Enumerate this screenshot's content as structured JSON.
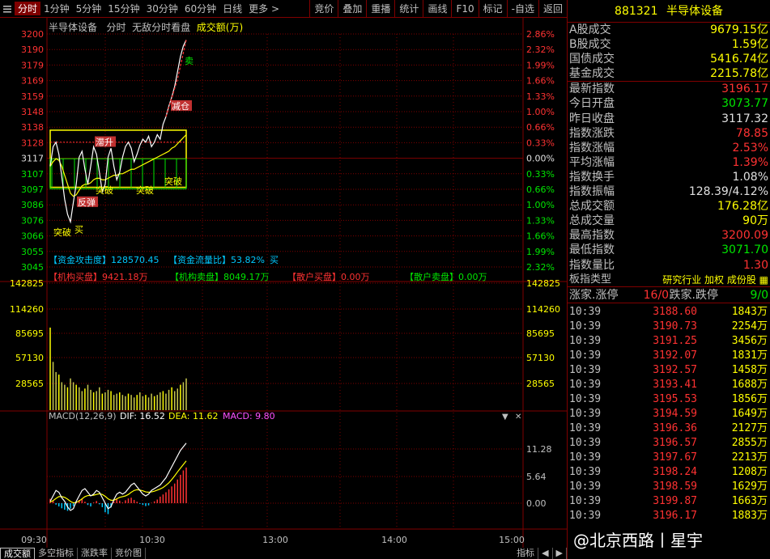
{
  "topbar": {
    "periods": [
      "分时",
      "1分钟",
      "5分钟",
      "15分钟",
      "30分钟",
      "60分钟",
      "日线",
      "更多 >"
    ],
    "tools": [
      "竞价",
      "叠加",
      "重播",
      "统计",
      "画线",
      "F10",
      "标记",
      "-自选",
      "返回"
    ]
  },
  "chart": {
    "name": "半导体设备",
    "mode": "分时",
    "desc": "无敌分时看盘",
    "sub": "成交额(万)",
    "price_axis": [
      "3200",
      "3190",
      "3179",
      "3169",
      "3159",
      "3148",
      "3138",
      "3128",
      "3117",
      "3107",
      "3097",
      "3086",
      "3076",
      "3066",
      "3055",
      "3045"
    ],
    "pct_axis": [
      "2.86%",
      "2.32%",
      "1.99%",
      "1.66%",
      "1.33%",
      "1.00%",
      "0.66%",
      "0.33%",
      "0.00%",
      "0.33%",
      "0.66%",
      "1.00%",
      "1.33%",
      "1.66%",
      "1.99%",
      "2.32%"
    ],
    "prev_close": 3117.32,
    "flow_row1": {
      "a": "【资金攻击度】128570.45",
      "b": "【资金流量比】53.82%",
      "b_tail": "买"
    },
    "flow_row2": [
      {
        "label": "【机构买盘】",
        "value": "9421.18万",
        "color": "#ff3232"
      },
      {
        "label": "【机构卖盘】",
        "value": "8049.17万",
        "color": "#00e600"
      },
      {
        "label": "【散户买盘】",
        "value": "0.00万",
        "color": "#ff3232"
      },
      {
        "label": "【散户卖盘】",
        "value": "0.00万",
        "color": "#00e600"
      }
    ],
    "vol_axis": [
      "142825",
      "114260",
      "85695",
      "57130",
      "28565"
    ],
    "macd_title": "MACD(12,26,9)",
    "macd_dif": "DIF: 16.52",
    "macd_dea": "DEA: 11.62",
    "macd_val": "MACD: 9.80",
    "macd_axis": [
      "11.28",
      "5.64",
      "0.00"
    ],
    "time_axis": [
      "09:30",
      "10:30",
      "13:00",
      "14:00",
      "15:00"
    ],
    "annotations": [
      "卖",
      "减仓",
      "滞升",
      "突破",
      "突破",
      "突破",
      "反弹",
      "突破",
      "买",
      "突破"
    ],
    "price_series": [
      3112,
      3125,
      3128,
      3120,
      3105,
      3090,
      3080,
      3075,
      3088,
      3100,
      3118,
      3122,
      3110,
      3100,
      3112,
      3125,
      3120,
      3108,
      3095,
      3100,
      3118,
      3124,
      3112,
      3103,
      3108,
      3118,
      3125,
      3128,
      3124,
      3115,
      3120,
      3126,
      3130,
      3128,
      3132,
      3125,
      3128,
      3133,
      3130,
      3140,
      3145,
      3152,
      3158,
      3165,
      3175,
      3185,
      3192,
      3196
    ],
    "avg_series": [
      3112,
      3115,
      3117,
      3116,
      3112,
      3106,
      3100,
      3094,
      3092,
      3093,
      3096,
      3099,
      3100,
      3100,
      3101,
      3103,
      3104,
      3104,
      3103,
      3103,
      3104,
      3105,
      3106,
      3106,
      3107,
      3107,
      3108,
      3109,
      3110,
      3110,
      3111,
      3112,
      3113,
      3114,
      3115,
      3116,
      3117,
      3118,
      3119,
      3120,
      3121,
      3122,
      3124,
      3125,
      3127,
      3129,
      3131,
      3133
    ],
    "volume_series": [
      0.65,
      0.38,
      0.3,
      0.28,
      0.22,
      0.2,
      0.18,
      0.25,
      0.22,
      0.2,
      0.18,
      0.15,
      0.17,
      0.2,
      0.16,
      0.14,
      0.15,
      0.18,
      0.13,
      0.14,
      0.16,
      0.15,
      0.12,
      0.13,
      0.14,
      0.12,
      0.11,
      0.13,
      0.12,
      0.1,
      0.12,
      0.14,
      0.11,
      0.12,
      0.1,
      0.13,
      0.11,
      0.12,
      0.14,
      0.15,
      0.13,
      0.16,
      0.18,
      0.15,
      0.17,
      0.2,
      0.22,
      0.25
    ],
    "macd_series": [
      1.2,
      0.8,
      -0.4,
      -0.9,
      -1.4,
      -1.8,
      -2.1,
      -1.5,
      -0.8,
      0.3,
      0.9,
      1.2,
      0.4,
      -0.5,
      -0.9,
      0.2,
      0.6,
      -0.3,
      -1.1,
      -2.5,
      -3.0,
      -1.2,
      0.5,
      1.1,
      0.7,
      0.2,
      0.8,
      1.3,
      1.5,
      0.9,
      0.4,
      -0.2,
      -0.5,
      -0.8,
      -0.6,
      0.1,
      0.5,
      1.0,
      1.8,
      2.4,
      3.0,
      3.8,
      4.6,
      5.4,
      6.5,
      7.8,
      9.0,
      9.8
    ],
    "dif_series": [
      0.5,
      2.0,
      3.5,
      3.0,
      1.5,
      0.5,
      -1.0,
      -2.0,
      -1.5,
      0.5,
      2.0,
      3.5,
      4.0,
      3.0,
      2.0,
      2.5,
      3.5,
      3.0,
      1.5,
      0.0,
      -1.5,
      -1.0,
      1.0,
      2.5,
      3.0,
      2.5,
      3.0,
      4.0,
      5.0,
      5.5,
      4.5,
      3.5,
      2.5,
      2.0,
      2.5,
      3.5,
      4.0,
      4.5,
      5.0,
      6.0,
      7.0,
      8.5,
      10.0,
      11.5,
      13.0,
      14.5,
      15.5,
      16.5
    ],
    "dea_series": [
      0.3,
      0.7,
      1.3,
      1.8,
      1.8,
      1.6,
      1.1,
      0.5,
      0.1,
      0.2,
      0.6,
      1.2,
      1.8,
      2.1,
      2.1,
      2.2,
      2.4,
      2.6,
      2.4,
      1.9,
      1.2,
      0.8,
      0.8,
      1.2,
      1.6,
      1.8,
      2.0,
      2.4,
      3.0,
      3.5,
      3.7,
      3.6,
      3.4,
      3.1,
      3.0,
      3.1,
      3.3,
      3.6,
      3.9,
      4.3,
      4.9,
      5.6,
      6.5,
      7.5,
      8.6,
      9.6,
      10.6,
      11.6
    ]
  },
  "right": {
    "code": "881321",
    "name": "半导体设备",
    "stats": [
      {
        "label": "A股成交",
        "value": "9679.15亿",
        "cls": "v-yellow"
      },
      {
        "label": "B股成交",
        "value": "1.59亿",
        "cls": "v-yellow"
      },
      {
        "label": "国债成交",
        "value": "5416.74亿",
        "cls": "v-yellow"
      },
      {
        "label": "基金成交",
        "value": "2215.78亿",
        "cls": "v-yellow"
      }
    ],
    "stats2": [
      {
        "label": "最新指数",
        "value": "3196.17",
        "cls": "v-red"
      },
      {
        "label": "今日开盘",
        "value": "3073.77",
        "cls": "v-green"
      },
      {
        "label": "昨日收盘",
        "value": "3117.32",
        "cls": "v-white"
      },
      {
        "label": "指数涨跌",
        "value": "78.85",
        "cls": "v-red"
      },
      {
        "label": "指数涨幅",
        "value": "2.53%",
        "cls": "v-red"
      },
      {
        "label": "平均涨幅",
        "value": "1.39%",
        "cls": "v-red"
      },
      {
        "label": "指数换手",
        "value": "1.08%",
        "cls": "v-white"
      },
      {
        "label": "指数振幅",
        "value": "128.39/4.12%",
        "cls": "v-white"
      },
      {
        "label": "总成交额",
        "value": "176.28亿",
        "cls": "v-yellow"
      },
      {
        "label": "总成交量",
        "value": "90万",
        "cls": "v-yellow"
      },
      {
        "label": "最高指数",
        "value": "3200.09",
        "cls": "v-red"
      },
      {
        "label": "最低指数",
        "value": "3071.70",
        "cls": "v-green"
      },
      {
        "label": "指数量比",
        "value": "1.30",
        "cls": "v-red"
      }
    ],
    "type_label": "板指类型",
    "type_value": "研究行业 加权 成份股",
    "updown": {
      "l1": "涨家.涨停",
      "v1": "16/0",
      "l2": "跌家.跌停",
      "v2": "9/0"
    },
    "ticks": [
      {
        "t": "10:39",
        "p": "3188.60",
        "v": "1843万"
      },
      {
        "t": "10:39",
        "p": "3190.73",
        "v": "2254万"
      },
      {
        "t": "10:39",
        "p": "3191.25",
        "v": "3456万"
      },
      {
        "t": "10:39",
        "p": "3192.07",
        "v": "1831万"
      },
      {
        "t": "10:39",
        "p": "3192.57",
        "v": "1458万"
      },
      {
        "t": "10:39",
        "p": "3193.41",
        "v": "1688万"
      },
      {
        "t": "10:39",
        "p": "3195.53",
        "v": "1856万"
      },
      {
        "t": "10:39",
        "p": "3194.59",
        "v": "1649万"
      },
      {
        "t": "10:39",
        "p": "3196.36",
        "v": "2127万"
      },
      {
        "t": "10:39",
        "p": "3196.57",
        "v": "2855万"
      },
      {
        "t": "10:39",
        "p": "3197.67",
        "v": "2213万"
      },
      {
        "t": "10:39",
        "p": "3198.24",
        "v": "1208万"
      },
      {
        "t": "10:39",
        "p": "3198.59",
        "v": "1629万"
      },
      {
        "t": "10:39",
        "p": "3199.87",
        "v": "1663万"
      },
      {
        "t": "10:39",
        "p": "3196.17",
        "v": "1883万"
      }
    ]
  },
  "bottom": {
    "tabs": [
      "成交额",
      "多空指标",
      "涨跌率",
      "竞价图"
    ],
    "right_tab": "指标"
  },
  "watermark": "@北京西路丨星宇"
}
